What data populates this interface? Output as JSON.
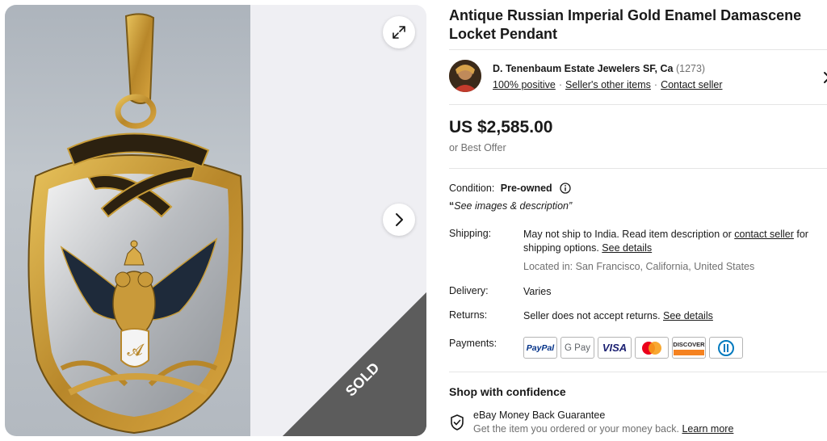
{
  "listing": {
    "title": "Antique Russian Imperial Gold Enamel Damascene Locket Pendant",
    "sold_label": "SOLD"
  },
  "seller": {
    "name": "D. Tenenbaum Estate Jewelers SF, Ca",
    "feedback_count": "(1273)",
    "positive": "100% positive",
    "other_items": "Seller's other items",
    "contact": "Contact seller"
  },
  "price": {
    "amount": "US $2,585.00",
    "offer": "or Best Offer"
  },
  "condition": {
    "label": "Condition:",
    "value": "Pre-owned",
    "note_quote": "“",
    "note": "See images & description",
    "note_end": "”"
  },
  "shipping": {
    "label": "Shipping:",
    "text1": "May not ship to India. Read item description or ",
    "contact_link": "contact seller",
    "text2": " for shipping options. ",
    "details_link": "See details",
    "location": "Located in: San Francisco, California, United States"
  },
  "delivery": {
    "label": "Delivery:",
    "value": "Varies"
  },
  "returns": {
    "label": "Returns:",
    "text": "Seller does not accept returns. ",
    "details_link": "See details"
  },
  "payments": {
    "label": "Payments:",
    "methods": [
      "PayPal",
      "G Pay",
      "VISA",
      "Mastercard",
      "DISCOVER",
      "Diners Club"
    ]
  },
  "confidence": {
    "title": "Shop with confidence",
    "guarantee_title": "eBay Money Back Guarantee",
    "guarantee_desc": "Get the item you ordered or your money back. ",
    "learn_more": "Learn more"
  },
  "icons": {
    "expand": "expand-icon",
    "next": "chevron-right-icon",
    "info": "info-icon",
    "shield": "shield-check-icon",
    "seller_chevron": "chevron-right-icon"
  },
  "colors": {
    "paypal_blue": "#003087",
    "visa_blue": "#1a1f71",
    "discover_orange": "#f58220",
    "sold_ribbon": "#5a5a5a"
  }
}
